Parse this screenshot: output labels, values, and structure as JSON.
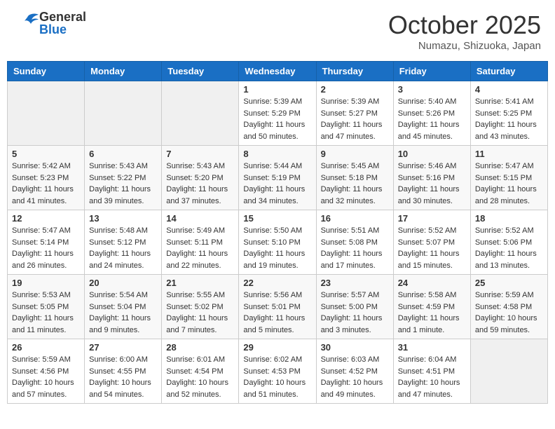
{
  "header": {
    "logo_general": "General",
    "logo_blue": "Blue",
    "month_title": "October 2025",
    "location": "Numazu, Shizuoka, Japan"
  },
  "weekdays": [
    "Sunday",
    "Monday",
    "Tuesday",
    "Wednesday",
    "Thursday",
    "Friday",
    "Saturday"
  ],
  "weeks": [
    [
      {
        "day": "",
        "info": ""
      },
      {
        "day": "",
        "info": ""
      },
      {
        "day": "",
        "info": ""
      },
      {
        "day": "1",
        "info": "Sunrise: 5:39 AM\nSunset: 5:29 PM\nDaylight: 11 hours\nand 50 minutes."
      },
      {
        "day": "2",
        "info": "Sunrise: 5:39 AM\nSunset: 5:27 PM\nDaylight: 11 hours\nand 47 minutes."
      },
      {
        "day": "3",
        "info": "Sunrise: 5:40 AM\nSunset: 5:26 PM\nDaylight: 11 hours\nand 45 minutes."
      },
      {
        "day": "4",
        "info": "Sunrise: 5:41 AM\nSunset: 5:25 PM\nDaylight: 11 hours\nand 43 minutes."
      }
    ],
    [
      {
        "day": "5",
        "info": "Sunrise: 5:42 AM\nSunset: 5:23 PM\nDaylight: 11 hours\nand 41 minutes."
      },
      {
        "day": "6",
        "info": "Sunrise: 5:43 AM\nSunset: 5:22 PM\nDaylight: 11 hours\nand 39 minutes."
      },
      {
        "day": "7",
        "info": "Sunrise: 5:43 AM\nSunset: 5:20 PM\nDaylight: 11 hours\nand 37 minutes."
      },
      {
        "day": "8",
        "info": "Sunrise: 5:44 AM\nSunset: 5:19 PM\nDaylight: 11 hours\nand 34 minutes."
      },
      {
        "day": "9",
        "info": "Sunrise: 5:45 AM\nSunset: 5:18 PM\nDaylight: 11 hours\nand 32 minutes."
      },
      {
        "day": "10",
        "info": "Sunrise: 5:46 AM\nSunset: 5:16 PM\nDaylight: 11 hours\nand 30 minutes."
      },
      {
        "day": "11",
        "info": "Sunrise: 5:47 AM\nSunset: 5:15 PM\nDaylight: 11 hours\nand 28 minutes."
      }
    ],
    [
      {
        "day": "12",
        "info": "Sunrise: 5:47 AM\nSunset: 5:14 PM\nDaylight: 11 hours\nand 26 minutes."
      },
      {
        "day": "13",
        "info": "Sunrise: 5:48 AM\nSunset: 5:12 PM\nDaylight: 11 hours\nand 24 minutes."
      },
      {
        "day": "14",
        "info": "Sunrise: 5:49 AM\nSunset: 5:11 PM\nDaylight: 11 hours\nand 22 minutes."
      },
      {
        "day": "15",
        "info": "Sunrise: 5:50 AM\nSunset: 5:10 PM\nDaylight: 11 hours\nand 19 minutes."
      },
      {
        "day": "16",
        "info": "Sunrise: 5:51 AM\nSunset: 5:08 PM\nDaylight: 11 hours\nand 17 minutes."
      },
      {
        "day": "17",
        "info": "Sunrise: 5:52 AM\nSunset: 5:07 PM\nDaylight: 11 hours\nand 15 minutes."
      },
      {
        "day": "18",
        "info": "Sunrise: 5:52 AM\nSunset: 5:06 PM\nDaylight: 11 hours\nand 13 minutes."
      }
    ],
    [
      {
        "day": "19",
        "info": "Sunrise: 5:53 AM\nSunset: 5:05 PM\nDaylight: 11 hours\nand 11 minutes."
      },
      {
        "day": "20",
        "info": "Sunrise: 5:54 AM\nSunset: 5:04 PM\nDaylight: 11 hours\nand 9 minutes."
      },
      {
        "day": "21",
        "info": "Sunrise: 5:55 AM\nSunset: 5:02 PM\nDaylight: 11 hours\nand 7 minutes."
      },
      {
        "day": "22",
        "info": "Sunrise: 5:56 AM\nSunset: 5:01 PM\nDaylight: 11 hours\nand 5 minutes."
      },
      {
        "day": "23",
        "info": "Sunrise: 5:57 AM\nSunset: 5:00 PM\nDaylight: 11 hours\nand 3 minutes."
      },
      {
        "day": "24",
        "info": "Sunrise: 5:58 AM\nSunset: 4:59 PM\nDaylight: 11 hours\nand 1 minute."
      },
      {
        "day": "25",
        "info": "Sunrise: 5:59 AM\nSunset: 4:58 PM\nDaylight: 10 hours\nand 59 minutes."
      }
    ],
    [
      {
        "day": "26",
        "info": "Sunrise: 5:59 AM\nSunset: 4:56 PM\nDaylight: 10 hours\nand 57 minutes."
      },
      {
        "day": "27",
        "info": "Sunrise: 6:00 AM\nSunset: 4:55 PM\nDaylight: 10 hours\nand 54 minutes."
      },
      {
        "day": "28",
        "info": "Sunrise: 6:01 AM\nSunset: 4:54 PM\nDaylight: 10 hours\nand 52 minutes."
      },
      {
        "day": "29",
        "info": "Sunrise: 6:02 AM\nSunset: 4:53 PM\nDaylight: 10 hours\nand 51 minutes."
      },
      {
        "day": "30",
        "info": "Sunrise: 6:03 AM\nSunset: 4:52 PM\nDaylight: 10 hours\nand 49 minutes."
      },
      {
        "day": "31",
        "info": "Sunrise: 6:04 AM\nSunset: 4:51 PM\nDaylight: 10 hours\nand 47 minutes."
      },
      {
        "day": "",
        "info": ""
      }
    ]
  ]
}
